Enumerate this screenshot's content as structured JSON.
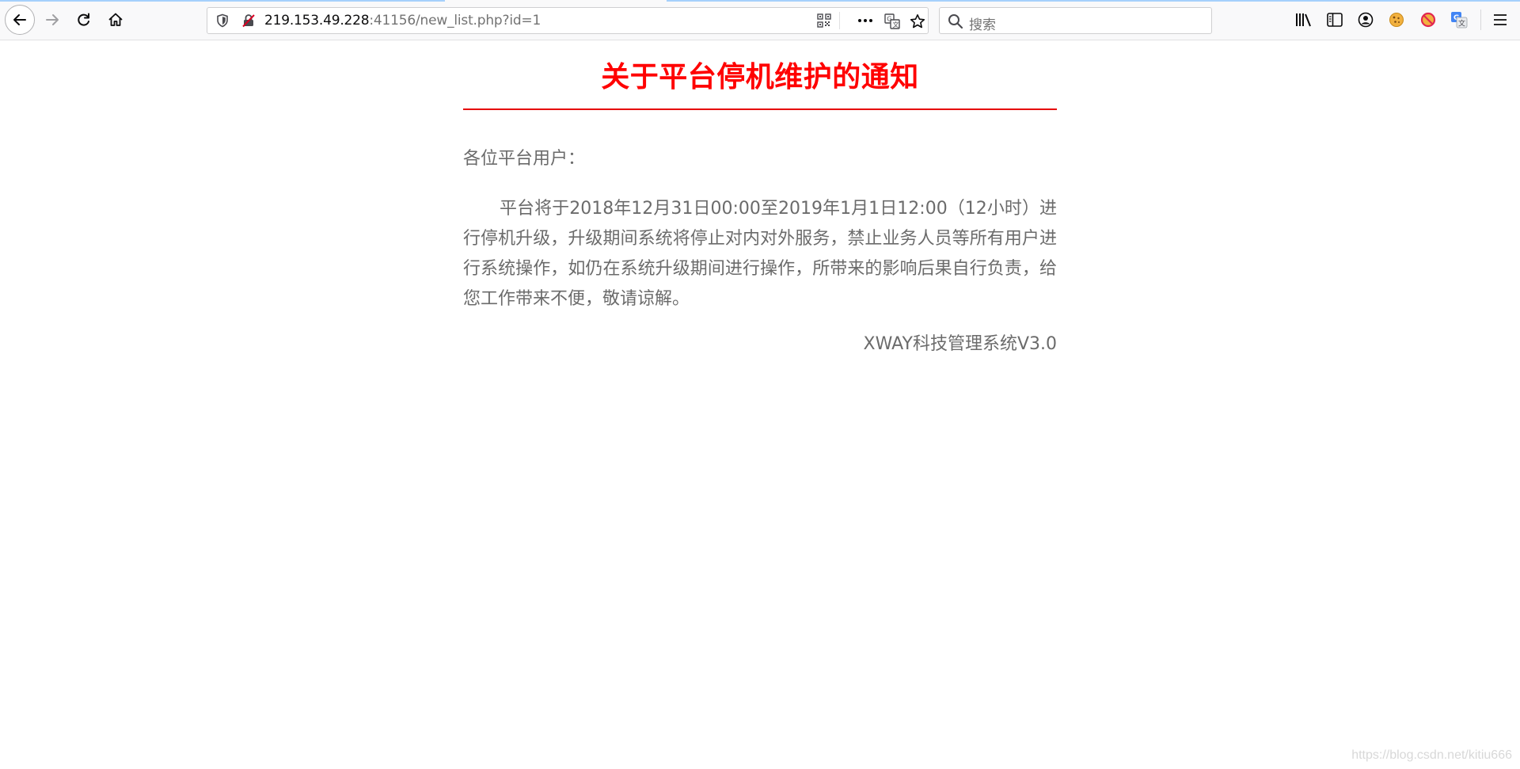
{
  "browser": {
    "url_host": "219.153.49.228",
    "url_rest": ":41156/new_list.php?id=1",
    "search_placeholder": "搜索"
  },
  "page": {
    "title": "关于平台停机维护的通知",
    "greeting": "各位平台用户：",
    "body": "平台将于2018年12月31日00:00至2019年1月1日12:00（12小时）进行停机升级，升级期间系统将停止对内对外服务，禁止业务人员等所有用户进行系统操作，如仍在系统升级期间进行操作，所带来的影响后果自行负责，给您工作带来不便，敬请谅解。",
    "signature": "XWAY科技管理系统V3.0",
    "title_color": "#ff0000",
    "text_color": "#6b6b6b"
  },
  "watermark": "https://blog.csdn.net/kitiu666",
  "icons": {
    "back": "back-arrow-icon",
    "forward": "forward-arrow-icon",
    "reload": "reload-icon",
    "home": "home-icon",
    "shield": "tracking-shield-icon",
    "insecure": "insecure-lock-icon",
    "qr": "qr-code-icon",
    "more": "more-actions-icon",
    "translate": "translate-icon",
    "bookmark": "bookmark-star-icon",
    "search": "search-icon",
    "library": "library-icon",
    "sidebar": "sidebar-icon",
    "account": "account-icon",
    "cookie": "cookie-extension-icon",
    "block": "block-extension-icon",
    "translate_ext": "translate-extension-icon",
    "menu": "hamburger-menu-icon"
  }
}
